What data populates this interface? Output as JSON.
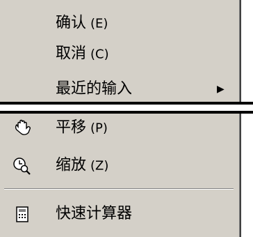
{
  "menu": {
    "items": [
      {
        "label": "确认",
        "hotkey": "(E)"
      },
      {
        "label": "取消",
        "hotkey": "(C)"
      },
      {
        "label": "最近的输入",
        "hotkey": "",
        "submenu_arrow": "▶"
      },
      {
        "label": "平移",
        "hotkey": "(P)",
        "icon": "pan-hand-icon"
      },
      {
        "label": "缩放",
        "hotkey": "(Z)",
        "icon": "zoom-icon"
      },
      {
        "label": "快速计算器",
        "hotkey": "",
        "icon": "calculator-icon"
      }
    ]
  },
  "colors": {
    "menu_background": "#d4d0c8",
    "separator_dark": "#808080",
    "cut_line": "#000000"
  }
}
